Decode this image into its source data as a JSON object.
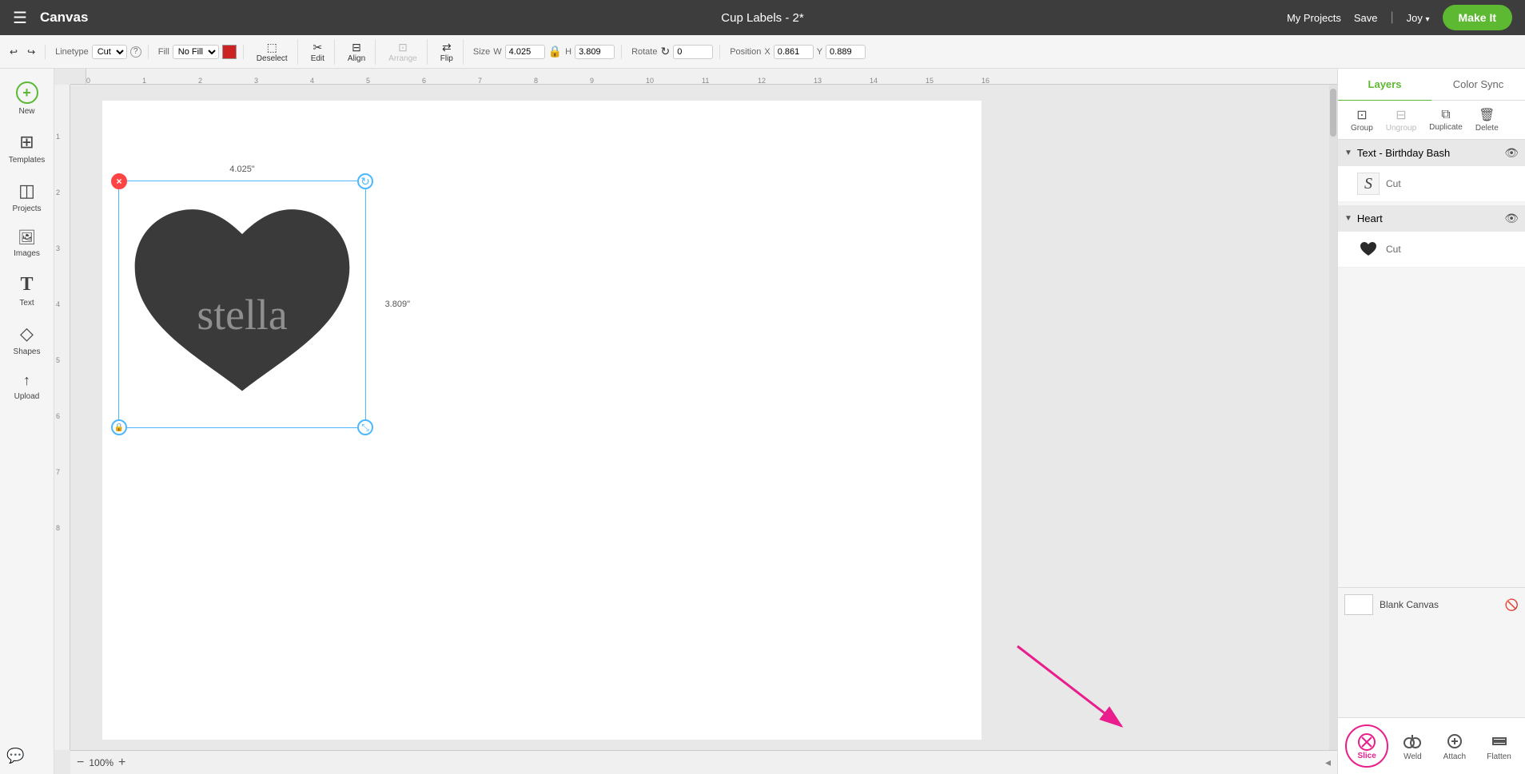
{
  "topbar": {
    "menu_label": "☰",
    "app_title": "Canvas",
    "project_title": "Cup Labels - 2*",
    "my_projects": "My Projects",
    "save": "Save",
    "divider": "|",
    "user_name": "Joy",
    "make_it": "Make It"
  },
  "toolbar": {
    "undo_label": "↩",
    "redo_label": "↪",
    "linetype_label": "Linetype",
    "linetype_value": "Cut",
    "linetype_q": "?",
    "fill_label": "Fill",
    "fill_value": "No Fill",
    "fill_color": "#cc2222",
    "deselect_label": "Deselect",
    "edit_label": "Edit",
    "align_label": "Align",
    "arrange_label": "Arrange",
    "flip_label": "Flip",
    "size_label": "Size",
    "size_w_label": "W",
    "size_w_value": "4.025",
    "size_h_label": "H",
    "size_h_value": "3.809",
    "rotate_label": "Rotate",
    "rotate_value": "0",
    "position_label": "Position",
    "pos_x_label": "X",
    "pos_x_value": "0.861",
    "pos_y_label": "Y",
    "pos_y_value": "0.889"
  },
  "sidebar": {
    "items": [
      {
        "icon": "+",
        "label": "New"
      },
      {
        "icon": "⊞",
        "label": "Templates"
      },
      {
        "icon": "◫",
        "label": "Projects"
      },
      {
        "icon": "🖼",
        "label": "Images"
      },
      {
        "icon": "T",
        "label": "Text"
      },
      {
        "icon": "◇",
        "label": "Shapes"
      },
      {
        "icon": "↑",
        "label": "Upload"
      }
    ]
  },
  "canvas": {
    "zoom": "100%",
    "dim_width": "4.025\"",
    "dim_height": "3.809\""
  },
  "right_panel": {
    "tabs": [
      {
        "label": "Layers",
        "active": true
      },
      {
        "label": "Color Sync",
        "active": false
      }
    ],
    "tools": [
      {
        "icon": "⊡",
        "label": "Group",
        "disabled": false
      },
      {
        "icon": "⊟",
        "label": "Ungroup",
        "disabled": true
      },
      {
        "icon": "⧉",
        "label": "Duplicate",
        "disabled": false
      },
      {
        "icon": "🗑",
        "label": "Delete",
        "disabled": false
      }
    ],
    "groups": [
      {
        "name": "Text - Birthday Bash",
        "expanded": true,
        "items": [
          {
            "label": "Cut",
            "thumb_type": "s-icon"
          }
        ]
      },
      {
        "name": "Heart",
        "expanded": true,
        "items": [
          {
            "label": "Cut",
            "thumb_type": "heart-icon"
          }
        ]
      }
    ],
    "blank_canvas": {
      "label": "Blank Canvas"
    },
    "bottom_actions": [
      {
        "icon": "⊘",
        "label": "Slice",
        "highlighted": true
      },
      {
        "icon": "⊕",
        "label": "Weld",
        "highlighted": false
      },
      {
        "icon": "⊙",
        "label": "Attach",
        "highlighted": false
      },
      {
        "icon": "⊟",
        "label": "Flatten",
        "highlighted": false
      }
    ]
  },
  "ruler": {
    "h_marks": [
      "0",
      "1",
      "2",
      "3",
      "4",
      "5",
      "6",
      "7",
      "8",
      "9",
      "10",
      "11",
      "12",
      "13",
      "14",
      "15",
      "16"
    ],
    "v_marks": [
      "1",
      "2",
      "3",
      "4",
      "5",
      "6",
      "7",
      "8"
    ]
  }
}
